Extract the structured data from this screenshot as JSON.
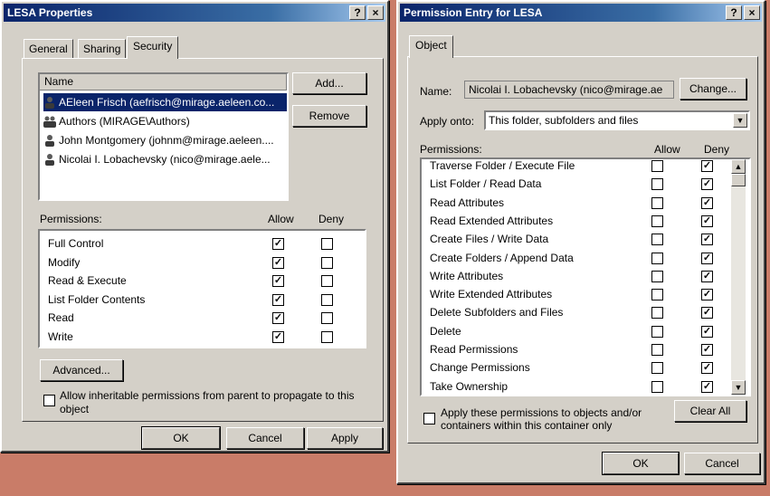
{
  "left_window": {
    "title": "LESA Properties",
    "title_buttons": [
      "?",
      "×"
    ],
    "tabs": [
      "General",
      "Sharing",
      "Security"
    ],
    "active_tab": "Security",
    "name_header": "Name",
    "users": [
      {
        "name": "AEleen Frisch (aefrisch@mirage.aeleen.co...",
        "selected": true
      },
      {
        "name": "Authors (MIRAGE\\Authors)",
        "selected": false
      },
      {
        "name": "John Montgomery (johnm@mirage.aeleen....",
        "selected": false
      },
      {
        "name": "Nicolai I. Lobachevsky (nico@mirage.aele...",
        "selected": false
      }
    ],
    "add_label": "Add...",
    "remove_label": "Remove",
    "permissions_label": "Permissions:",
    "allow_label": "Allow",
    "deny_label": "Deny",
    "permissions": [
      {
        "name": "Full Control",
        "allow": true,
        "deny": false
      },
      {
        "name": "Modify",
        "allow": true,
        "deny": false
      },
      {
        "name": "Read & Execute",
        "allow": true,
        "deny": false
      },
      {
        "name": "List Folder Contents",
        "allow": true,
        "deny": false
      },
      {
        "name": "Read",
        "allow": true,
        "deny": false
      },
      {
        "name": "Write",
        "allow": true,
        "deny": false
      }
    ],
    "advanced_label": "Advanced...",
    "inherit_text_1": "Allow inheritable permissions from parent to propagate to this",
    "inherit_text_2": "object",
    "ok_label": "OK",
    "cancel_label": "Cancel",
    "apply_label": "Apply"
  },
  "right_window": {
    "title": "Permission Entry for LESA",
    "title_buttons": [
      "?",
      "×"
    ],
    "tab": "Object",
    "name_label": "Name:",
    "name_value": "Nicolai I. Lobachevsky (nico@mirage.ae",
    "change_label": "Change...",
    "apply_onto_label": "Apply onto:",
    "apply_onto_value": "This folder, subfolders and files",
    "permissions_label": "Permissions:",
    "allow_label": "Allow",
    "deny_label": "Deny",
    "permissions": [
      {
        "name": "Traverse Folder / Execute File",
        "allow": false,
        "deny": true
      },
      {
        "name": "List Folder / Read Data",
        "allow": false,
        "deny": true
      },
      {
        "name": "Read Attributes",
        "allow": false,
        "deny": true
      },
      {
        "name": "Read Extended Attributes",
        "allow": false,
        "deny": true
      },
      {
        "name": "Create Files / Write Data",
        "allow": false,
        "deny": true
      },
      {
        "name": "Create Folders / Append Data",
        "allow": false,
        "deny": true
      },
      {
        "name": "Write Attributes",
        "allow": false,
        "deny": true
      },
      {
        "name": "Write Extended Attributes",
        "allow": false,
        "deny": true
      },
      {
        "name": "Delete Subfolders and Files",
        "allow": false,
        "deny": true
      },
      {
        "name": "Delete",
        "allow": false,
        "deny": true
      },
      {
        "name": "Read Permissions",
        "allow": false,
        "deny": true
      },
      {
        "name": "Change Permissions",
        "allow": false,
        "deny": true
      },
      {
        "name": "Take Ownership",
        "allow": false,
        "deny": true
      }
    ],
    "apply_within_text_1": "Apply these permissions to objects and/or",
    "apply_within_text_2": "containers within this container only",
    "clear_all_label": "Clear All",
    "ok_label": "OK",
    "cancel_label": "Cancel"
  }
}
